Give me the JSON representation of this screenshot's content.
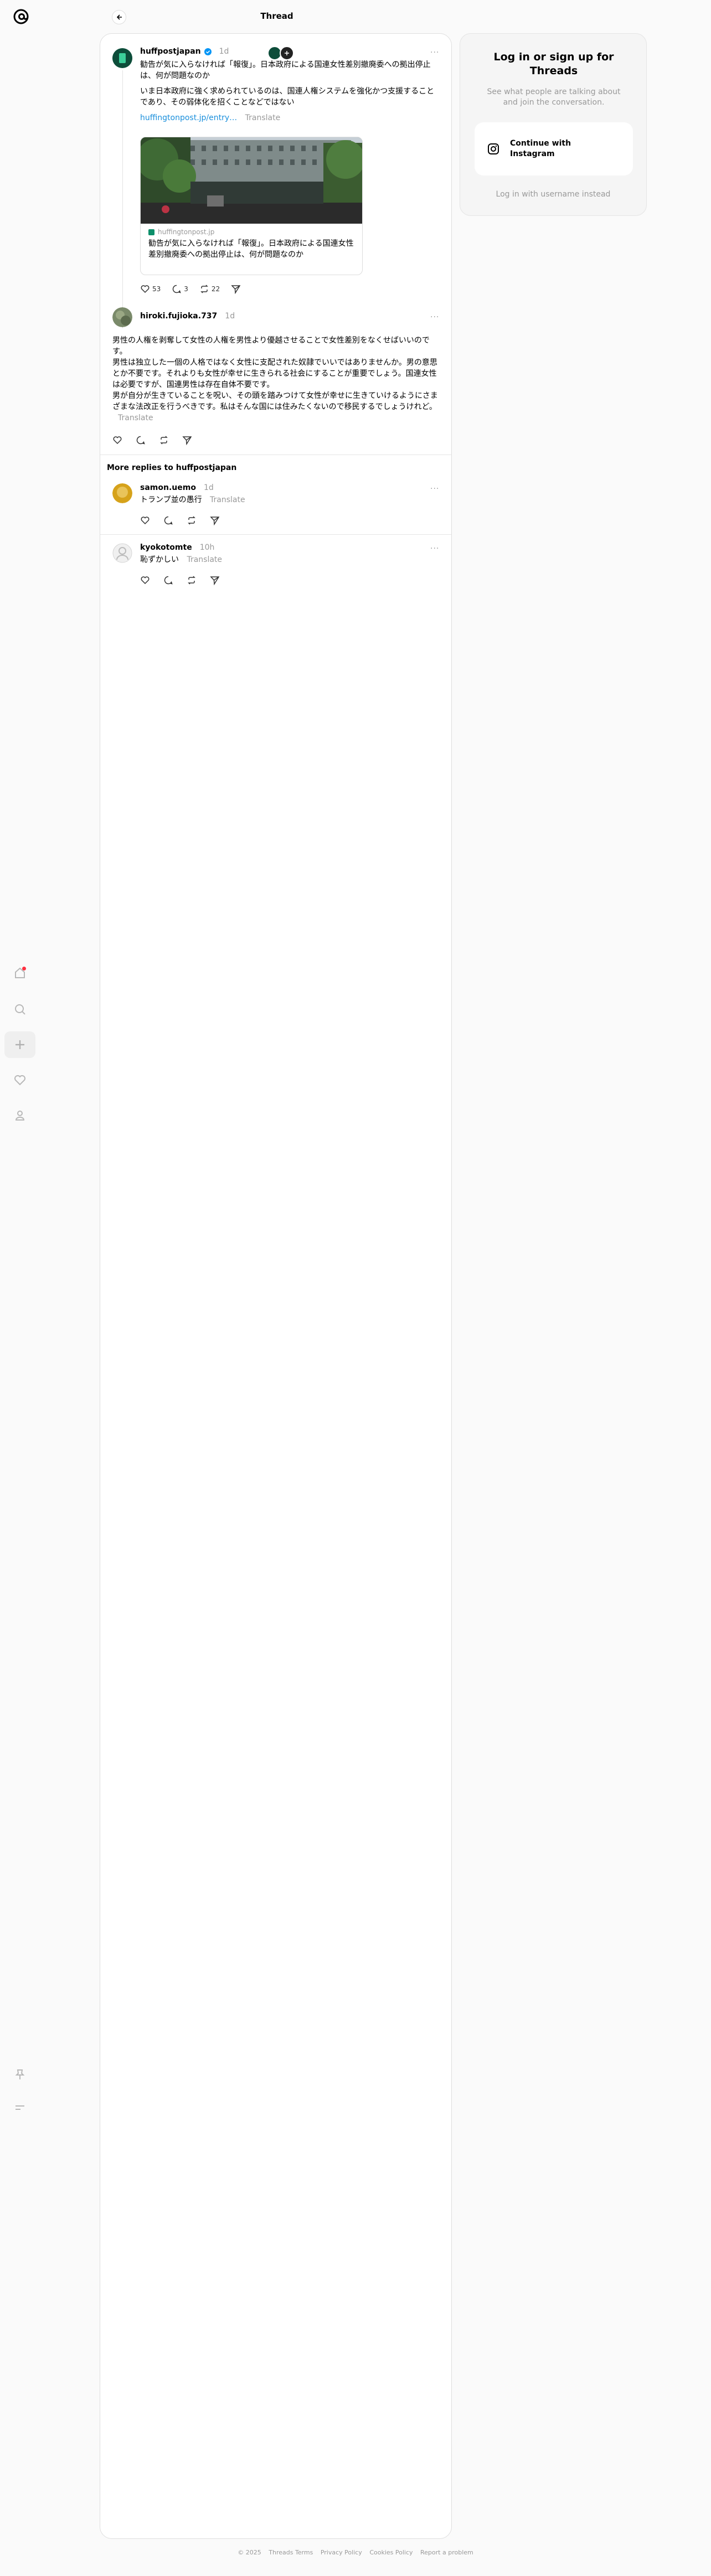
{
  "header": {
    "title": "Thread"
  },
  "main_post": {
    "username": "huffpostjapan",
    "time": "1d",
    "text1": "勧告が気に入らなければ「報復」。日本政府による国連女性差別撤廃委への拠出停止は、何が問題なのか",
    "text2": "いま日本政府に強く求められているのは、国連人権システムを強化かつ支援することであり、その弱体化を招くことなどではない",
    "link": "huffingtonpost.jp/entry…",
    "translate": "Translate",
    "card": {
      "domain": "huffingtonpost.jp",
      "title": "勧告が気に入らなければ「報復」。日本政府による国連女性差別撤廃委への拠出停止は、何が問題なのか"
    },
    "likes": "53",
    "replies": "3",
    "reposts": "22"
  },
  "reply1": {
    "username": "hiroki.fujioka.737",
    "time": "1d",
    "lines": [
      "男性の人権を剥奪して女性の人権を男性より優越させることで女性差別をなくせばいいのです。",
      "男性は独立した一個の人格ではなく女性に支配された奴隷でいいではありませんか。男の意思とか不要です。それよりも女性が幸せに生きられる社会にすることが重要でしょう。国連女性は必要ですが、国連男性は存在自体不要です。",
      "男が自分が生きていることを呪い、その頭を踏みつけて女性が幸せに生きていけるようにさまざまな法改正を行うべきです。私はそんな国には住みたくないので移民するでしょうけれど。"
    ],
    "translate": "Translate"
  },
  "more_replies": {
    "label": "More replies to huffpostjapan"
  },
  "reply2": {
    "username": "samon.uemo",
    "time": "1d",
    "text": "トランプ並の愚行",
    "translate": "Translate"
  },
  "reply3": {
    "username": "kyokotomte",
    "time": "10h",
    "text": "恥ずかしい",
    "translate": "Translate"
  },
  "login_panel": {
    "title": "Log in or sign up for Threads",
    "subtitle": "See what people are talking about and join the conversation.",
    "instagram_button": "Continue with Instagram",
    "username_link": "Log in with username instead"
  },
  "footer": {
    "items": [
      "© 2025",
      "Threads Terms",
      "Privacy Policy",
      "Cookies Policy",
      "Report a problem"
    ]
  },
  "colors": {
    "accent": "#0095f6",
    "link": "#1a8fdc",
    "notif": "#ff3040"
  }
}
